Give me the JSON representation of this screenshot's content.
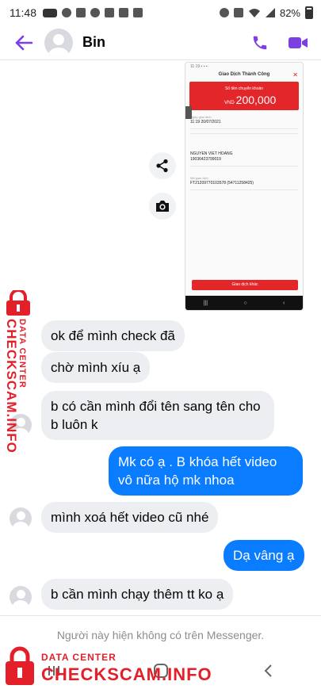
{
  "status_bar": {
    "time": "11:48",
    "battery": "82%"
  },
  "header": {
    "contact_name": "Bin"
  },
  "shared_image": {
    "title": "Giao Dịch Thành Công",
    "amount_label": "Số tiền chuyển khoản",
    "currency": "VND",
    "amount": "200,000",
    "date_label": "Ngày giao dịch",
    "date_value": "11:19 20/07/2021",
    "account_name": "NGUYEN VIET HOANG",
    "account_number": "19036423799019",
    "tx_label": "Mã giao dịch",
    "tx_value": "FT21209770103578 (54711258425)",
    "button_label": "Giao dịch khác"
  },
  "messages": [
    {
      "dir": "in",
      "text": "ok để mình check đã"
    },
    {
      "dir": "in",
      "text": "chờ mình xíu ạ"
    },
    {
      "dir": "in",
      "text": "b có cần mình đổi tên sang tên cho b luôn k"
    },
    {
      "dir": "out",
      "text": "Mk có ạ . B khóa hết video vô nữa hộ mk nhoa"
    },
    {
      "dir": "in",
      "text": "mình xoá hết video cũ nhé"
    },
    {
      "dir": "out",
      "text": "Dạ vâng ạ"
    },
    {
      "dir": "in",
      "text": "b cần mình chạy thêm tt ko ạ"
    }
  ],
  "footer": {
    "unavailable_text": "Người này hiện không có trên Messenger."
  },
  "watermark": {
    "small": "DATA CENTER",
    "big": "CHECKSCAM.INFO"
  },
  "colors": {
    "accent": "#7b3fe4",
    "outgoing_bubble": "#0a7cff",
    "incoming_bubble": "#eceef1",
    "watermark_red": "#e3202a"
  }
}
